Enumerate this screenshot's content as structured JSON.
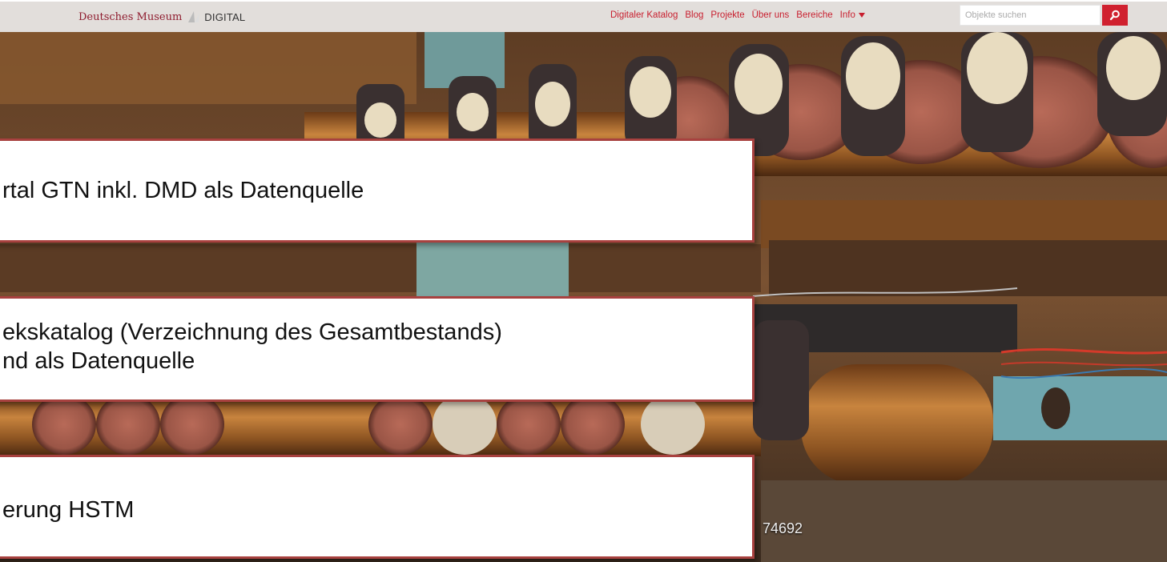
{
  "header": {
    "logo_text": "Deutsches Museum",
    "logo_suffix": "DIGITAL",
    "nav": [
      "Digitaler Katalog",
      "Blog",
      "Projekte",
      "Über uns",
      "Bereiche",
      "Info"
    ],
    "search_placeholder": "Objekte suchen",
    "colors": {
      "accent": "#d0212f",
      "logo": "#8e1b2e"
    }
  },
  "callouts": [
    {
      "text": "rtal GTN inkl. DMD als Datenquelle"
    },
    {
      "text": "ekskatalog (Verzeichnung des Gesamtbestands)\nnd als Datenquelle"
    },
    {
      "text": "erung HSTM"
    }
  ],
  "photo": {
    "inventory_number": "74692"
  }
}
